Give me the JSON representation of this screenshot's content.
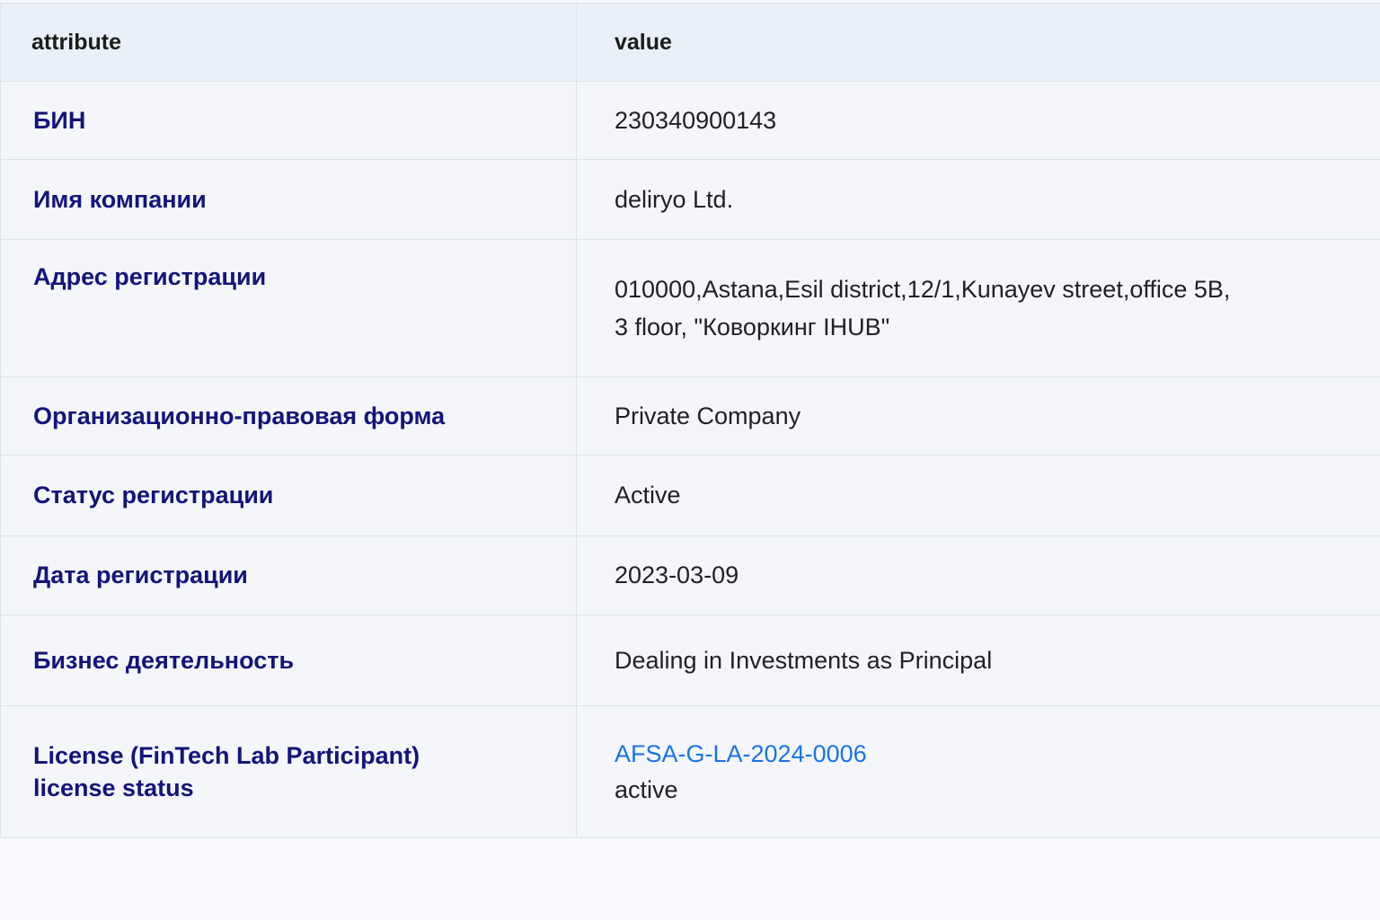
{
  "table": {
    "headers": {
      "attribute": "attribute",
      "value": "value"
    },
    "rows": {
      "bin": {
        "label": "БИН",
        "value": "230340900143"
      },
      "company_name": {
        "label": "Имя компании",
        "value": "deliryo Ltd."
      },
      "address": {
        "label": "Адрес регистрации",
        "line1": "010000,Astana,Esil district,12/1,Kunayev street,office 5B,",
        "line2": "3 floor, \"Коворкинг IHUB\""
      },
      "legal_form": {
        "label": "Организационно-правовая форма",
        "value": "Private Company"
      },
      "reg_status": {
        "label": "Статус регистрации",
        "value": "Active"
      },
      "reg_date": {
        "label": "Дата регистрации",
        "value": "2023-03-09"
      },
      "business": {
        "label": "Бизнес деятельность",
        "value": "Dealing in Investments as Principal"
      },
      "license": {
        "label_line1": "License (FinTech Lab Participant)",
        "label_line2": "license status",
        "link": "AFSA-G-LA-2024-0006",
        "status": "active"
      }
    }
  },
  "colors": {
    "label": "#14147a",
    "link": "#1a73e8",
    "header_bg": "#e9f0f8"
  }
}
